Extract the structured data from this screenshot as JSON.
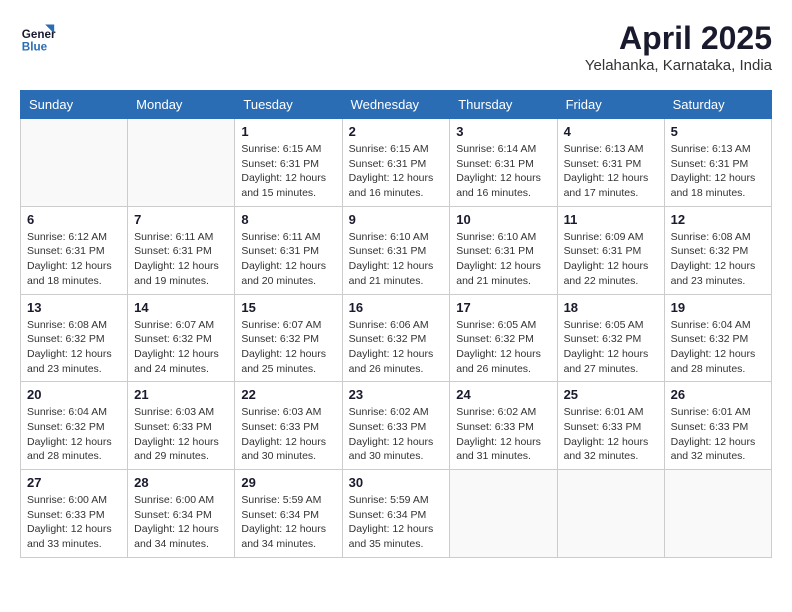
{
  "header": {
    "logo_line1": "General",
    "logo_line2": "Blue",
    "month_year": "April 2025",
    "location": "Yelahanka, Karnataka, India"
  },
  "weekdays": [
    "Sunday",
    "Monday",
    "Tuesday",
    "Wednesday",
    "Thursday",
    "Friday",
    "Saturday"
  ],
  "weeks": [
    [
      {
        "day": "",
        "info": ""
      },
      {
        "day": "",
        "info": ""
      },
      {
        "day": "1",
        "info": "Sunrise: 6:15 AM\nSunset: 6:31 PM\nDaylight: 12 hours\nand 15 minutes."
      },
      {
        "day": "2",
        "info": "Sunrise: 6:15 AM\nSunset: 6:31 PM\nDaylight: 12 hours\nand 16 minutes."
      },
      {
        "day": "3",
        "info": "Sunrise: 6:14 AM\nSunset: 6:31 PM\nDaylight: 12 hours\nand 16 minutes."
      },
      {
        "day": "4",
        "info": "Sunrise: 6:13 AM\nSunset: 6:31 PM\nDaylight: 12 hours\nand 17 minutes."
      },
      {
        "day": "5",
        "info": "Sunrise: 6:13 AM\nSunset: 6:31 PM\nDaylight: 12 hours\nand 18 minutes."
      }
    ],
    [
      {
        "day": "6",
        "info": "Sunrise: 6:12 AM\nSunset: 6:31 PM\nDaylight: 12 hours\nand 18 minutes."
      },
      {
        "day": "7",
        "info": "Sunrise: 6:11 AM\nSunset: 6:31 PM\nDaylight: 12 hours\nand 19 minutes."
      },
      {
        "day": "8",
        "info": "Sunrise: 6:11 AM\nSunset: 6:31 PM\nDaylight: 12 hours\nand 20 minutes."
      },
      {
        "day": "9",
        "info": "Sunrise: 6:10 AM\nSunset: 6:31 PM\nDaylight: 12 hours\nand 21 minutes."
      },
      {
        "day": "10",
        "info": "Sunrise: 6:10 AM\nSunset: 6:31 PM\nDaylight: 12 hours\nand 21 minutes."
      },
      {
        "day": "11",
        "info": "Sunrise: 6:09 AM\nSunset: 6:31 PM\nDaylight: 12 hours\nand 22 minutes."
      },
      {
        "day": "12",
        "info": "Sunrise: 6:08 AM\nSunset: 6:32 PM\nDaylight: 12 hours\nand 23 minutes."
      }
    ],
    [
      {
        "day": "13",
        "info": "Sunrise: 6:08 AM\nSunset: 6:32 PM\nDaylight: 12 hours\nand 23 minutes."
      },
      {
        "day": "14",
        "info": "Sunrise: 6:07 AM\nSunset: 6:32 PM\nDaylight: 12 hours\nand 24 minutes."
      },
      {
        "day": "15",
        "info": "Sunrise: 6:07 AM\nSunset: 6:32 PM\nDaylight: 12 hours\nand 25 minutes."
      },
      {
        "day": "16",
        "info": "Sunrise: 6:06 AM\nSunset: 6:32 PM\nDaylight: 12 hours\nand 26 minutes."
      },
      {
        "day": "17",
        "info": "Sunrise: 6:05 AM\nSunset: 6:32 PM\nDaylight: 12 hours\nand 26 minutes."
      },
      {
        "day": "18",
        "info": "Sunrise: 6:05 AM\nSunset: 6:32 PM\nDaylight: 12 hours\nand 27 minutes."
      },
      {
        "day": "19",
        "info": "Sunrise: 6:04 AM\nSunset: 6:32 PM\nDaylight: 12 hours\nand 28 minutes."
      }
    ],
    [
      {
        "day": "20",
        "info": "Sunrise: 6:04 AM\nSunset: 6:32 PM\nDaylight: 12 hours\nand 28 minutes."
      },
      {
        "day": "21",
        "info": "Sunrise: 6:03 AM\nSunset: 6:33 PM\nDaylight: 12 hours\nand 29 minutes."
      },
      {
        "day": "22",
        "info": "Sunrise: 6:03 AM\nSunset: 6:33 PM\nDaylight: 12 hours\nand 30 minutes."
      },
      {
        "day": "23",
        "info": "Sunrise: 6:02 AM\nSunset: 6:33 PM\nDaylight: 12 hours\nand 30 minutes."
      },
      {
        "day": "24",
        "info": "Sunrise: 6:02 AM\nSunset: 6:33 PM\nDaylight: 12 hours\nand 31 minutes."
      },
      {
        "day": "25",
        "info": "Sunrise: 6:01 AM\nSunset: 6:33 PM\nDaylight: 12 hours\nand 32 minutes."
      },
      {
        "day": "26",
        "info": "Sunrise: 6:01 AM\nSunset: 6:33 PM\nDaylight: 12 hours\nand 32 minutes."
      }
    ],
    [
      {
        "day": "27",
        "info": "Sunrise: 6:00 AM\nSunset: 6:33 PM\nDaylight: 12 hours\nand 33 minutes."
      },
      {
        "day": "28",
        "info": "Sunrise: 6:00 AM\nSunset: 6:34 PM\nDaylight: 12 hours\nand 34 minutes."
      },
      {
        "day": "29",
        "info": "Sunrise: 5:59 AM\nSunset: 6:34 PM\nDaylight: 12 hours\nand 34 minutes."
      },
      {
        "day": "30",
        "info": "Sunrise: 5:59 AM\nSunset: 6:34 PM\nDaylight: 12 hours\nand 35 minutes."
      },
      {
        "day": "",
        "info": ""
      },
      {
        "day": "",
        "info": ""
      },
      {
        "day": "",
        "info": ""
      }
    ]
  ]
}
